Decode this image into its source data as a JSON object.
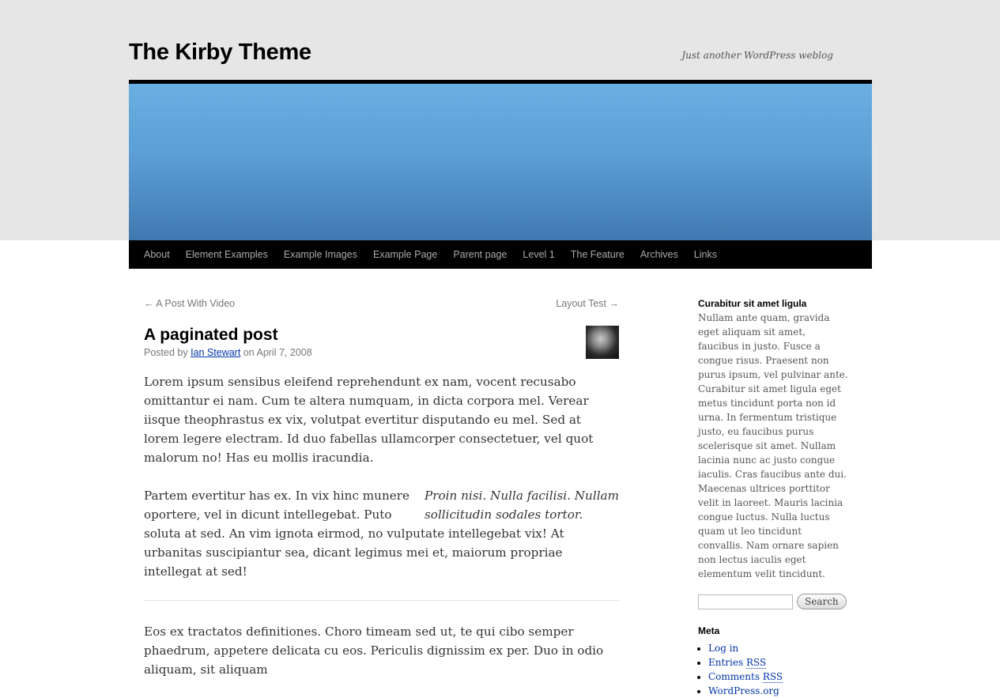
{
  "site": {
    "title": "The Kirby Theme",
    "description": "Just another WordPress weblog"
  },
  "nav": {
    "items": [
      "About",
      "Element Examples",
      "Example Images",
      "Example Page",
      "Parent page",
      "Level 1",
      "The Feature",
      "Archives",
      "Links"
    ]
  },
  "post_nav": {
    "prev": "← A Post With Video",
    "next": "Layout Test →"
  },
  "post": {
    "title": "A paginated post",
    "meta_prefix": "Posted by ",
    "author": "Ian Stewart",
    "meta_on": " on ",
    "date": "April 7, 2008",
    "p1": "Lorem ipsum sensibus eleifend reprehendunt ex nam, vocent recusabo omittantur ei nam. Cum te altera numquam, in dicta corpora mel. Verear iisque theophrastus ex vix, volutpat evertitur disputando eu mel. Sed at lorem legere electram. Id duo fabellas ullamcorper consectetuer, vel quot malorum no! Has eu mollis iracundia.",
    "pullquote": "Proin nisi. Nulla facilisi. Nullam sollicitudin sodales tortor.",
    "p2": "Partem evertitur has ex. In vix hinc munere oportere, vel in dicunt intellegebat. Puto soluta at sed. An vim ignota eirmod, no vulputate intellegebat vix! At urbanitas suscipiantur sea, dicant legimus mei et, maiorum propriae intellegat at sed!",
    "p3": "Eos ex tractatos definitiones. Choro timeam sed ut, te qui cibo semper phaedrum, appetere delicata cu eos. Periculis dignissim ex per. Duo in odio aliquam, sit aliquam"
  },
  "sidebar": {
    "widget_title": "Curabitur sit amet ligula",
    "widget_text": "Nullam ante quam, gravida eget aliquam sit amet, faucibus in justo. Fusce a congue risus. Praesent non purus ipsum, vel pulvinar ante. Curabitur sit amet ligula eget metus tincidunt porta non id urna. In fermentum tristique justo, eu faucibus purus scelerisque sit amet. Nullam lacinia nunc ac justo congue iaculis. Cras faucibus ante dui. Maecenas ultrices porttitor velit in laoreet. Mauris lacinia congue luctus. Nulla luctus quam ut leo tincidunt convallis. Nam ornare sapien non lectus iaculis eget elementum velit tincidunt.",
    "search": {
      "value": "",
      "button": "Search"
    },
    "meta": {
      "title": "Meta",
      "login": "Log in",
      "entries_label": "Entries",
      "comments_label": "Comments",
      "rss": "RSS",
      "wordpress": "WordPress.org"
    }
  },
  "colors": {
    "header_gradient_top": "#6aaee2",
    "header_gradient_bottom": "#4079b1",
    "nav_bg": "#000000",
    "link": "#0033aa"
  }
}
